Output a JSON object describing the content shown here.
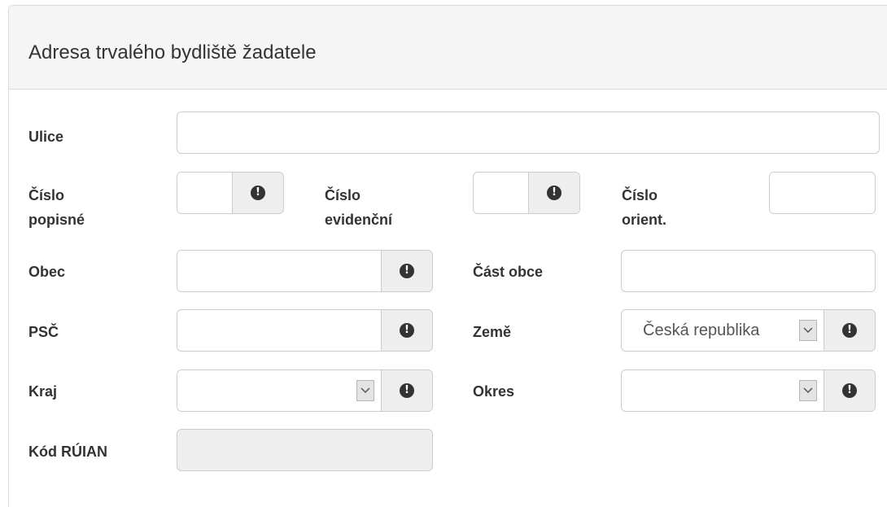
{
  "panel": {
    "title": "Adresa trvalého bydliště žadatele"
  },
  "fields": {
    "ulice": {
      "label": "Ulice",
      "value": ""
    },
    "cislo_popisne": {
      "label_line1": "Číslo",
      "label_line2": "popisné",
      "value": ""
    },
    "cislo_evidencni": {
      "label_line1": "Číslo",
      "label_line2": "evidenční",
      "value": ""
    },
    "cislo_orient": {
      "label_line1": "Číslo",
      "label_line2": "orient.",
      "value": ""
    },
    "obec": {
      "label": "Obec",
      "value": ""
    },
    "cast_obce": {
      "label": "Část obce",
      "value": ""
    },
    "psc": {
      "label": "PSČ",
      "value": ""
    },
    "zeme": {
      "label": "Země",
      "selected": "Česká republika"
    },
    "kraj": {
      "label": "Kraj",
      "selected": ""
    },
    "okres": {
      "label": "Okres",
      "selected": ""
    },
    "kod_ruian": {
      "label": "Kód RÚIAN",
      "value": ""
    }
  },
  "icons": {
    "info": "exclamation-circle-icon",
    "dropdown": "chevron-down-icon"
  },
  "info_glyph": "!"
}
